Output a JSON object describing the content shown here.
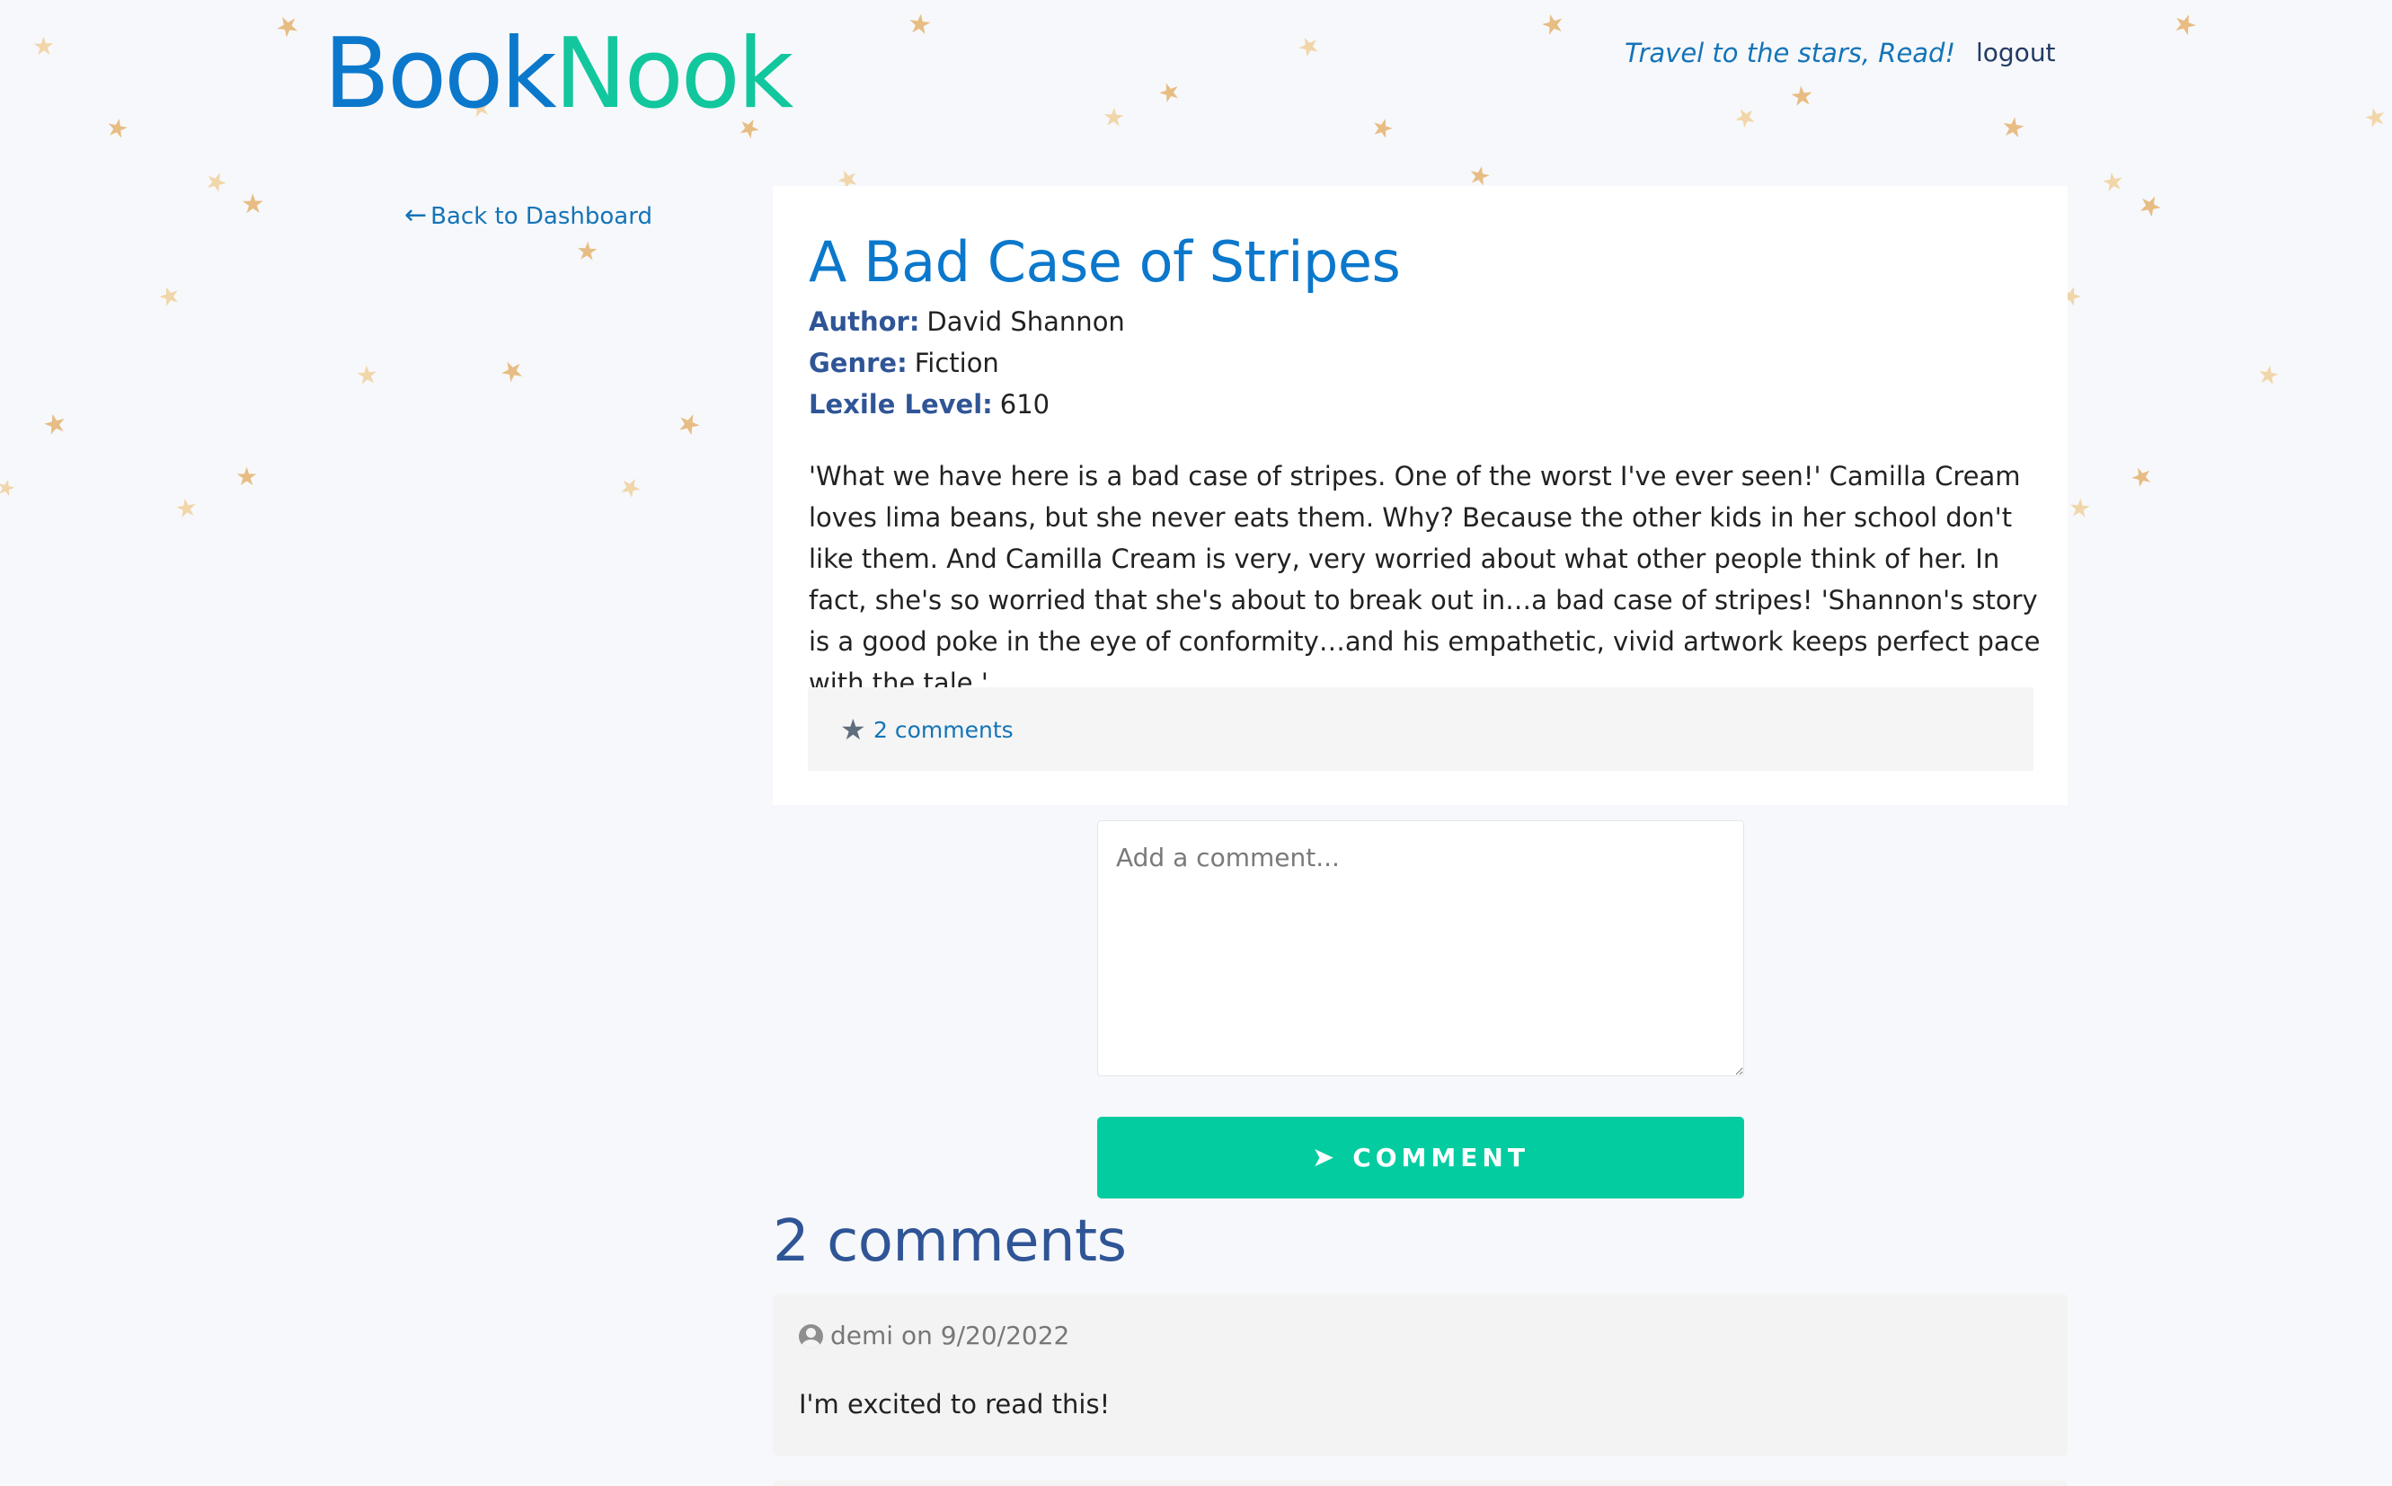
{
  "header": {
    "logo": {
      "part1": "Book",
      "part2": "Nook"
    },
    "tagline": "Travel to the stars, Read!",
    "logout_label": "logout"
  },
  "back_link": {
    "arrow_icon": "arrow-left-icon",
    "label": "Back to Dashboard"
  },
  "book": {
    "title": "A Bad Case of Stripes",
    "author_label": "Author:",
    "author": "David Shannon",
    "genre_label": "Genre:",
    "genre": "Fiction",
    "lexile_label": "Lexile Level:",
    "lexile": "610",
    "description": "'What we have here is a bad case of stripes. One of the worst I've ever seen!' Camilla Cream loves lima beans, but she never eats them. Why? Because the other kids in her school don't like them. And Camilla Cream is very, very worried about what other people think of her. In fact, she's so worried that she's about to break out in…a bad case of stripes! 'Shannon's story is a good poke in the eye of conformity…and his empathetic, vivid artwork keeps perfect pace with the tale.'",
    "footer_icon": "star-icon",
    "comment_count_link": "2 comments"
  },
  "comment_form": {
    "placeholder": "Add a comment...",
    "value": "",
    "button_icon": "paper-plane-icon",
    "button_label": "COMMENT"
  },
  "comments_section": {
    "heading": "2 comments",
    "comments": [
      {
        "icon": "user-circle-icon",
        "user": "demi",
        "on_word": "on",
        "date": "9/20/2022",
        "text": "I'm excited to read this!"
      }
    ]
  },
  "colors": {
    "brand_blue": "#0b78cc",
    "brand_green": "#12c79d",
    "button_green": "#04cca1",
    "label_navy": "#2f5596",
    "link_blue": "#1474b8",
    "star_gold": "#e7bd84"
  }
}
